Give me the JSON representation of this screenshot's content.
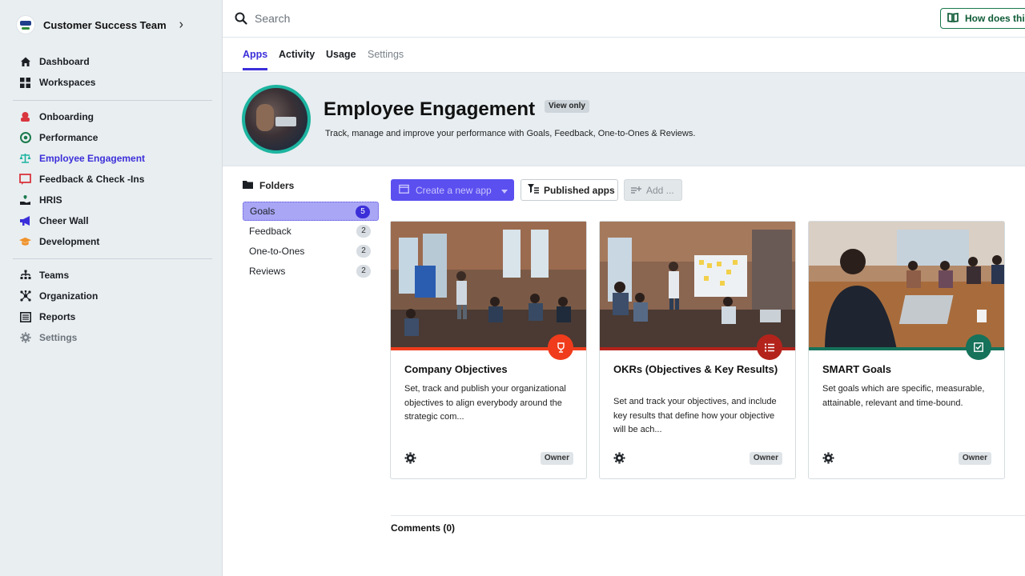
{
  "sidebar": {
    "team_name": "Customer Success Team",
    "groups": [
      [
        {
          "label": "Dashboard",
          "icon": "home-icon"
        },
        {
          "label": "Workspaces",
          "icon": "grid-icon"
        }
      ],
      [
        {
          "label": "Onboarding",
          "icon": "onboarding-icon",
          "color": "#d9363e"
        },
        {
          "label": "Performance",
          "icon": "target-icon",
          "color": "#1a7a4c"
        },
        {
          "label": "Employee Engagement",
          "icon": "scale-icon",
          "color": "#1cb4a0",
          "active": true
        },
        {
          "label": "Feedback & Check -Ins",
          "icon": "feedback-icon",
          "color": "#d9363e"
        },
        {
          "label": "HRIS",
          "icon": "hand-plant-icon",
          "color": "#1a7a4c"
        },
        {
          "label": "Cheer Wall",
          "icon": "megaphone-icon",
          "color": "#3b2fd9"
        },
        {
          "label": "Development",
          "icon": "graduation-cap-icon",
          "color": "#f0932b"
        }
      ],
      [
        {
          "label": "Teams",
          "icon": "org-chart-icon"
        },
        {
          "label": "Organization",
          "icon": "network-icon"
        },
        {
          "label": "Reports",
          "icon": "report-icon"
        },
        {
          "label": "Settings",
          "icon": "gear-icon",
          "muted": true
        }
      ]
    ]
  },
  "topbar": {
    "search_placeholder": "Search",
    "help_label": "How does this work?"
  },
  "tabs": [
    {
      "label": "Apps",
      "active": true
    },
    {
      "label": "Activity"
    },
    {
      "label": "Usage"
    },
    {
      "label": "Settings",
      "muted": true
    }
  ],
  "header": {
    "title": "Employee Engagement",
    "badge": "View only",
    "description": "Track, manage and improve your performance with Goals, Feedback, One-to-Ones & Reviews."
  },
  "folders": {
    "title": "Folders",
    "items": [
      {
        "label": "Goals",
        "count": "5",
        "active": true
      },
      {
        "label": "Feedback",
        "count": "2"
      },
      {
        "label": "One-to-Ones",
        "count": "2"
      },
      {
        "label": "Reviews",
        "count": "2"
      }
    ]
  },
  "toolbar": {
    "create_label": "Create a new app",
    "published_label": "Published apps",
    "add_label": "Add ..."
  },
  "cards": [
    {
      "title": "Company Objectives",
      "description": "Set, track and publish your organizational objectives to align everybody around the strategic com...",
      "owner": "Owner",
      "accent": "#f03c1c",
      "badge_icon": "trophy-icon"
    },
    {
      "title": "OKRs (Objectives & Key Results)",
      "description": "Set and track your objectives, and include key results that define how your objective will be ach...",
      "owner": "Owner",
      "accent": "#b3231b",
      "badge_icon": "list-icon"
    },
    {
      "title": "SMART Goals",
      "description": "Set goals which are specific, measurable, attainable, relevant and time-bound.",
      "owner": "Owner",
      "accent": "#16725a",
      "badge_icon": "checkbox-icon"
    }
  ],
  "comments": {
    "label": "Comments (0)"
  }
}
